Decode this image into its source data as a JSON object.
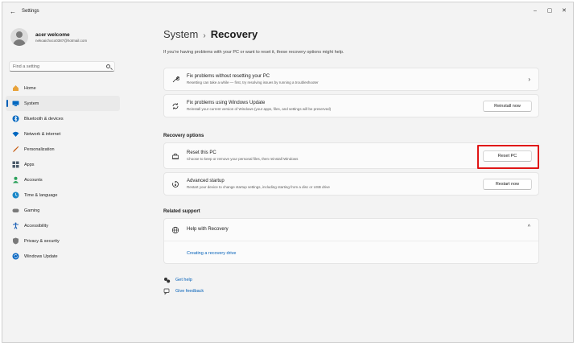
{
  "titlebar": {
    "title": "Settings",
    "back_icon": "←",
    "minimize": "–",
    "maximize": "▢",
    "close": "✕"
  },
  "profile": {
    "name": "acer welcome",
    "email": "nekoaichoco0387@hotmail.com"
  },
  "search": {
    "placeholder": "Find a setting"
  },
  "sidebar": {
    "items": [
      {
        "label": "Home",
        "icon": "home-icon",
        "color": "#e8a23a"
      },
      {
        "label": "System",
        "icon": "system-icon",
        "color": "#0067c0"
      },
      {
        "label": "Bluetooth & devices",
        "icon": "bluetooth-icon",
        "color": "#0067c0"
      },
      {
        "label": "Network & internet",
        "icon": "network-icon",
        "color": "#0067c0"
      },
      {
        "label": "Personalization",
        "icon": "brush-icon",
        "color": "#c65a10"
      },
      {
        "label": "Apps",
        "icon": "apps-icon",
        "color": "#4a5a6a"
      },
      {
        "label": "Accounts",
        "icon": "accounts-icon",
        "color": "#2aa05a"
      },
      {
        "label": "Time & language",
        "icon": "time-language-icon",
        "color": "#1a87c8"
      },
      {
        "label": "Gaming",
        "icon": "gaming-icon",
        "color": "#7a7a7a"
      },
      {
        "label": "Accessibility",
        "icon": "accessibility-icon",
        "color": "#1a5fb4"
      },
      {
        "label": "Privacy & security",
        "icon": "shield-icon",
        "color": "#7a7a7a"
      },
      {
        "label": "Windows Update",
        "icon": "windows-update-icon",
        "color": "#0a67c2"
      }
    ],
    "active_index": 1
  },
  "page": {
    "breadcrumb_parent": "System",
    "breadcrumb_sep": "›",
    "title": "Recovery",
    "intro": "If you're having problems with your PC or want to reset it, these recovery options might help."
  },
  "fix_cards": {
    "fix_without_reset": {
      "title": "Fix problems without resetting your PC",
      "desc": "Resetting can take a while — first, try resolving issues by running a troubleshooter"
    },
    "fix_windows_update": {
      "title": "Fix problems using Windows Update",
      "desc": "Reinstall your current version of Windows (your apps, files, and settings will be preserved)",
      "button": "Reinstall now"
    }
  },
  "recovery_options": {
    "heading": "Recovery options",
    "reset": {
      "title": "Reset this PC",
      "desc": "Choose to keep or remove your personal files, then reinstall Windows",
      "button": "Reset PC"
    },
    "advanced": {
      "title": "Advanced startup",
      "desc": "Restart your device to change startup settings, including starting from a disc or USB drive",
      "button": "Restart now"
    }
  },
  "related_support": {
    "heading": "Related support",
    "help_title": "Help with Recovery",
    "link": "Creating a recovery drive"
  },
  "footer_links": {
    "get_help": "Get help",
    "give_feedback": "Give feedback"
  },
  "colors": {
    "accent": "#005fb8",
    "highlight": "#e01515"
  }
}
